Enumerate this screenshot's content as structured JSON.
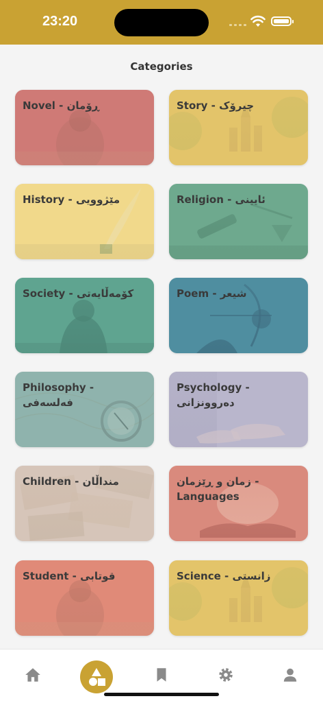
{
  "status_bar": {
    "time": "23:20",
    "accent_color": "#c9a233",
    "icons": [
      "cellular-signal-icon",
      "wifi-icon",
      "battery-icon"
    ]
  },
  "page": {
    "title": "Categories"
  },
  "categories": [
    {
      "label": "Novel - ڕۆمان",
      "tint": "#cf7a76",
      "image": "woman-in-mist-photo"
    },
    {
      "label": "Story - چیرۆک",
      "tint": "#e3c46a",
      "image": "fairytale-castle-illustration"
    },
    {
      "label": "History - مێژوویی",
      "tint": "#f1d98b",
      "image": "quill-and-inkpot-photo"
    },
    {
      "label": "Religion - ئایینی",
      "tint": "#6ea98e",
      "image": "scales-and-gavel-photo"
    },
    {
      "label": "Society - کۆمەڵایەتی",
      "tint": "#5fa490",
      "image": "hooded-figure-photo"
    },
    {
      "label": "Poem - شیعر",
      "tint": "#4f8ea0",
      "image": "archer-fantasy-art"
    },
    {
      "label": "Philosophy - فەلسەفی",
      "tint": "#8fb3ad",
      "image": "compass-on-map-photo"
    },
    {
      "label": "Psychology - دەروونزانی",
      "tint": "#b9b6cc",
      "image": "hands-on-desk-photo"
    },
    {
      "label": "Children - منداڵان",
      "tint": "#d6c5b9",
      "image": "banknotes-photo"
    },
    {
      "label": "زمان و ڕێزمان - Languages",
      "tint": "#d98a7d",
      "image": "glowing-book-photo"
    },
    {
      "label": "Student - قوتابی",
      "tint": "#e08a78",
      "image": "woman-in-mist-photo"
    },
    {
      "label": "Science - زانستی",
      "tint": "#e3c46a",
      "image": "fairytale-castle-illustration"
    }
  ],
  "bottom_nav": {
    "items": [
      {
        "icon": "home-icon",
        "active": false
      },
      {
        "icon": "categories-icon",
        "active": true
      },
      {
        "icon": "bookmark-icon",
        "active": false
      },
      {
        "icon": "settings-icon",
        "active": false
      },
      {
        "icon": "profile-icon",
        "active": false
      }
    ],
    "active_color": "#c9a233",
    "inactive_color": "#8a8a8a"
  }
}
